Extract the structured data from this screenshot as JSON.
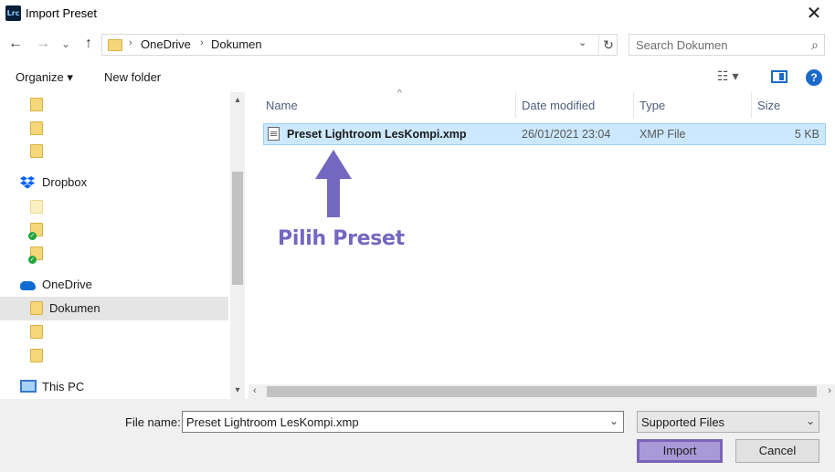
{
  "window": {
    "app_icon_text": "Lrc",
    "title": "Import Preset",
    "close_glyph": "✕"
  },
  "navbar": {
    "back_glyph": "←",
    "forward_glyph": "→",
    "recent_glyph": "⌄",
    "up_glyph": "↑",
    "breadcrumbs": [
      "OneDrive",
      "Dokumen"
    ],
    "refresh_glyph": "↻",
    "search_placeholder": "Search Dokumen"
  },
  "toolbar": {
    "organize_label": "Organize ▾",
    "new_folder_label": "New folder",
    "view_glyph": "☷ ▾",
    "help_glyph": "?"
  },
  "nav_pane": {
    "items": [
      {
        "type": "folder",
        "label": ""
      },
      {
        "type": "folder",
        "label": ""
      },
      {
        "type": "folder",
        "label": ""
      },
      {
        "type": "dropbox",
        "label": "Dropbox"
      },
      {
        "type": "folder-pale",
        "label": ""
      },
      {
        "type": "folder-synced",
        "label": ""
      },
      {
        "type": "folder-synced",
        "label": ""
      },
      {
        "type": "onedrive",
        "label": "OneDrive"
      },
      {
        "type": "folder",
        "label": "Dokumen",
        "selected": true
      },
      {
        "type": "folder",
        "label": ""
      },
      {
        "type": "folder",
        "label": ""
      },
      {
        "type": "pc",
        "label": "This PC"
      }
    ]
  },
  "file_list": {
    "columns": [
      "Name",
      "Date modified",
      "Type",
      "Size"
    ],
    "rows": [
      {
        "name": "Preset Lightroom LesKompi.xmp",
        "date_modified": "26/01/2021 23:04",
        "type": "XMP File",
        "size": "5 KB",
        "selected": true
      }
    ],
    "annotation": "Pilih Preset",
    "annotation_color": "#7367c0"
  },
  "footer": {
    "file_name_label": "File name:",
    "file_name_value": "Preset Lightroom LesKompi.xmp",
    "file_type_value": "Supported Files",
    "import_label": "Import",
    "cancel_label": "Cancel"
  }
}
